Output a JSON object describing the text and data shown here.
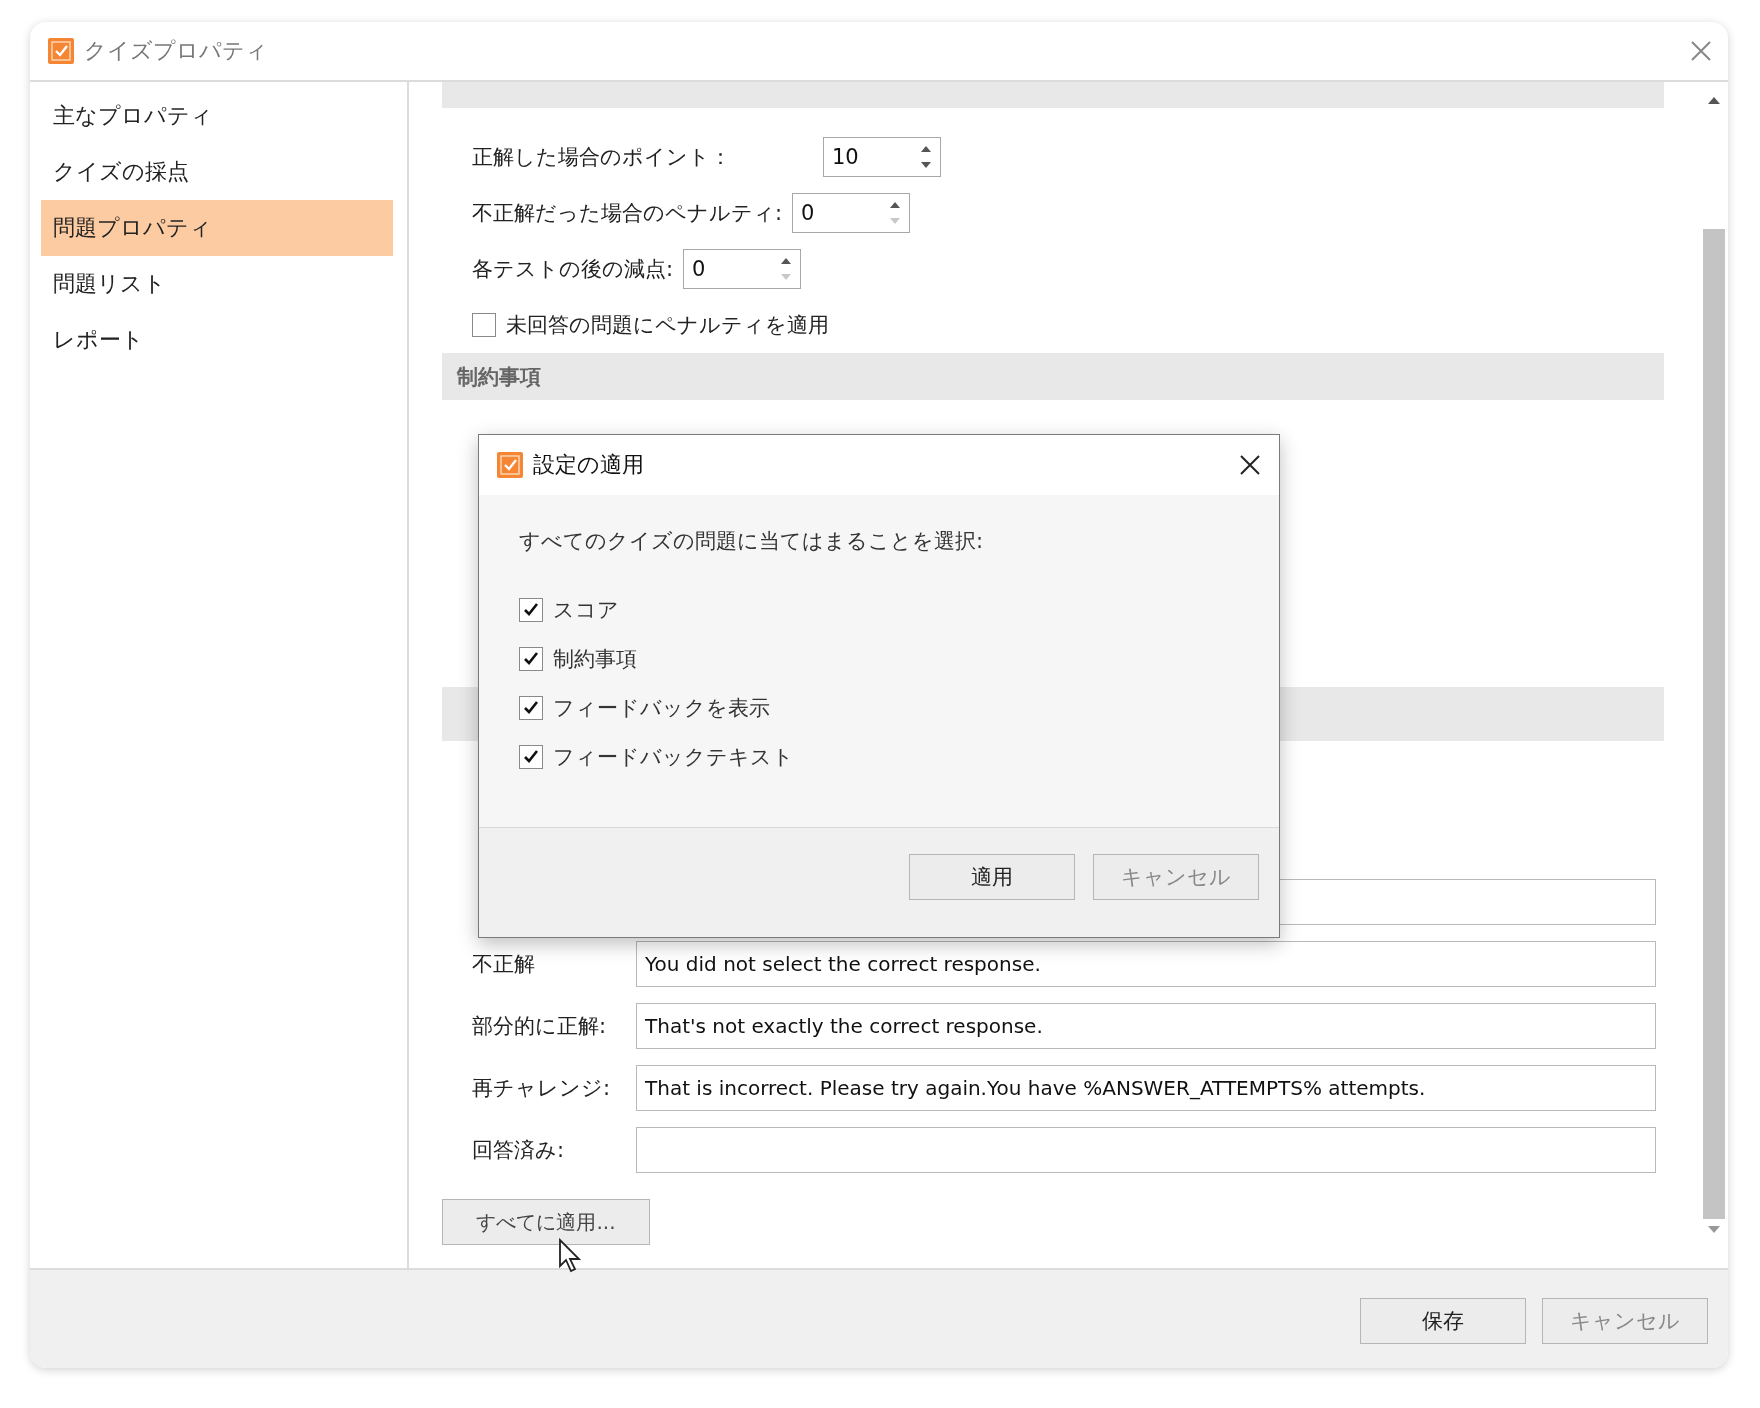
{
  "window": {
    "title": "クイズプロパティ"
  },
  "sidebar": {
    "items": [
      {
        "label": "主なプロパティ",
        "selected": false
      },
      {
        "label": "クイズの採点",
        "selected": false
      },
      {
        "label": "問題プロパティ",
        "selected": true
      },
      {
        "label": "問題リスト",
        "selected": false
      },
      {
        "label": "レポート",
        "selected": false
      }
    ]
  },
  "score": {
    "fields": [
      {
        "label": "正解した場合のポイント：",
        "value": "10",
        "down_disabled": false
      },
      {
        "label": "不正解だった場合のペナルティ:",
        "value": "0",
        "down_disabled": true
      },
      {
        "label": "各テストの後の減点:",
        "value": "0",
        "down_disabled": true
      }
    ],
    "checkbox": {
      "label": "未回答の問題にペナルティを適用",
      "checked": false
    }
  },
  "constraints": {
    "title": "制約事項"
  },
  "feedback": {
    "rows": [
      {
        "label": "不正解",
        "value": "You did not select the correct response."
      },
      {
        "label": "部分的に正解:",
        "value": "That's not exactly the correct response."
      },
      {
        "label": "再チャレンジ:",
        "value": "That is incorrect. Please try again.You have %ANSWER_ATTEMPTS% attempts."
      },
      {
        "label": "回答済み:"
      }
    ],
    "apply_all_button": "すべてに適用..."
  },
  "footer": {
    "buttons": [
      {
        "label": "保存",
        "disabled": false
      },
      {
        "label": "キャンセル",
        "disabled": true
      }
    ]
  },
  "dialog": {
    "title": "設定の適用",
    "prompt": "すべてのクイズの問題に当てはまることを選択:",
    "options": [
      {
        "label": "スコア",
        "checked": true
      },
      {
        "label": "制約事項",
        "checked": true
      },
      {
        "label": "フィードバックを表示",
        "checked": true
      },
      {
        "label": "フィードバックテキスト",
        "checked": true
      }
    ],
    "buttons": [
      {
        "label": "適用",
        "disabled": false
      },
      {
        "label": "キャンセル",
        "disabled": true
      }
    ]
  }
}
